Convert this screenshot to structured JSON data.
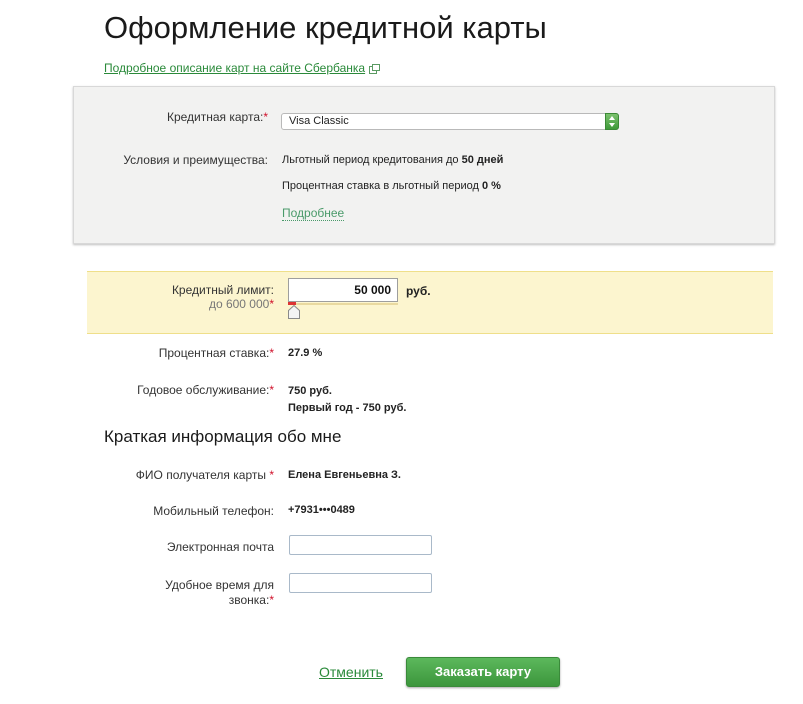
{
  "page": {
    "title": "Оформление кредитной карты",
    "cards_link": "Подробное описание карт на сайте Сбербанка"
  },
  "card_section": {
    "card_label": "Кредитная карта:",
    "card_required": "*",
    "card_selected": "Visa Classic",
    "conditions_label": "Условия и преимущества:",
    "grace_period_text": "Льготный период кредитования до ",
    "grace_period_value": "50 дней",
    "grace_rate_text": "Процентная ставка в льготный период ",
    "grace_rate_value": "0 %",
    "more_link": "Подробнее"
  },
  "limit_section": {
    "limit_label": "Кредитный лимит:",
    "limit_max": "до 600 000",
    "limit_required": "*",
    "limit_value": "50 000",
    "currency": "руб.",
    "slider_level_percent": 2
  },
  "terms": {
    "rate_label": "Процентная ставка:",
    "rate_required": "*",
    "rate_value": "27.9 %",
    "service_label": "Годовое обслуживание:",
    "service_required": "*",
    "service_value": "750 руб.",
    "service_first_year": "Первый год - 750 руб."
  },
  "personal": {
    "section_title": "Краткая информация обо мне",
    "name_label": "ФИО получателя карты",
    "name_required": "*",
    "name_value": "Елена Евгеньевна З.",
    "phone_label": "Мобильный телефон:",
    "phone_value": "+7931•••0489",
    "email_label": "Электронная почта",
    "email_value": "",
    "call_time_label_line1": "Удобное время для",
    "call_time_label_line2": "звонка:",
    "call_time_required": "*",
    "call_time_value": ""
  },
  "actions": {
    "cancel_label": "Отменить",
    "order_label": "Заказать карту"
  },
  "colors": {
    "accent_green": "#3c963c",
    "link_green": "#2a8a3a",
    "required_red": "#d0102a",
    "limit_band": "#fcf5cf"
  },
  "icons": {
    "external_link": "external-link-icon",
    "select_arrows": "select-arrows-icon",
    "slider_handle": "slider-handle-icon"
  }
}
